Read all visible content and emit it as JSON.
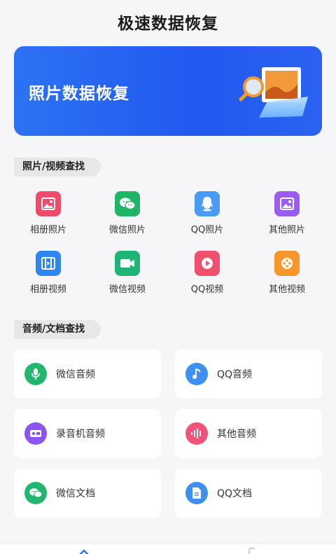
{
  "app": {
    "title": "极速数据恢复"
  },
  "banner": {
    "title": "照片数据恢复",
    "illustration": "photo-folder-magnifier"
  },
  "photo_section": {
    "title": "照片/视频查找",
    "items": [
      {
        "label": "相册照片",
        "icon": "gallery-photo-icon",
        "color": "#ef4b6c"
      },
      {
        "label": "微信照片",
        "icon": "wechat-icon",
        "color": "#1fb565"
      },
      {
        "label": "QQ照片",
        "icon": "qq-icon",
        "color": "#4a9bf5"
      },
      {
        "label": "其他照片",
        "icon": "image-icon",
        "color": "#9b5cf0"
      },
      {
        "label": "相册视频",
        "icon": "film-icon",
        "color": "#2f86ef"
      },
      {
        "label": "微信视频",
        "icon": "video-camera-icon",
        "color": "#1fb579"
      },
      {
        "label": "QQ视频",
        "icon": "play-icon",
        "color": "#f0506e"
      },
      {
        "label": "其他视频",
        "icon": "film-reel-icon",
        "color": "#f7962a"
      }
    ]
  },
  "audio_section": {
    "title": "音频/文档查找",
    "items": [
      {
        "label": "微信音频",
        "icon": "microphone-icon",
        "color": "#22b66f"
      },
      {
        "label": "QQ音频",
        "icon": "music-note-icon",
        "color": "#3d8ff0"
      },
      {
        "label": "录音机音频",
        "icon": "recorder-icon",
        "color": "#8b56f0"
      },
      {
        "label": "其他音频",
        "icon": "sound-wave-icon",
        "color": "#f0537a"
      },
      {
        "label": "微信文档",
        "icon": "wechat-icon",
        "color": "#22b66f"
      },
      {
        "label": "QQ文档",
        "icon": "document-icon",
        "color": "#3d8ff0"
      }
    ]
  },
  "bottom_nav": {
    "items": [
      {
        "icon": "home-icon"
      },
      {
        "icon": "profile-icon"
      }
    ]
  }
}
